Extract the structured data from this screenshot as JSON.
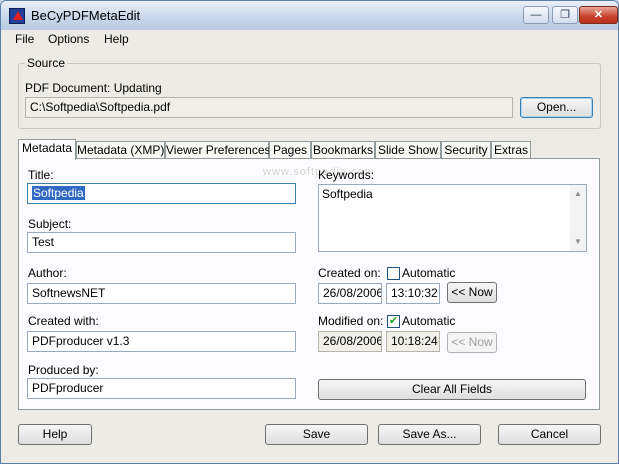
{
  "window": {
    "title": "BeCyPDFMetaEdit"
  },
  "titlebar_buttons": {
    "minimize": "—",
    "restore": "❐",
    "close": "✕"
  },
  "menu": [
    "File",
    "Options",
    "Help"
  ],
  "source": {
    "group_label": "Source",
    "doc_label": "PDF Document:  Updating",
    "path": "C:\\Softpedia\\Softpedia.pdf",
    "open_button": "Open..."
  },
  "tabs": [
    "Metadata",
    "Metadata (XMP)",
    "Viewer Preferences",
    "Pages",
    "Bookmarks",
    "Slide Show",
    "Security",
    "Extras"
  ],
  "metadata": {
    "title_label": "Title:",
    "title_value": "Softpedia",
    "subject_label": "Subject:",
    "subject_value": "Test",
    "author_label": "Author:",
    "author_value": "SoftnewsNET",
    "created_with_label": "Created with:",
    "created_with_value": "PDFproducer  v1.3",
    "produced_by_label": "Produced by:",
    "produced_by_value": "PDFproducer",
    "keywords_label": "Keywords:",
    "keywords_value": "Softpedia",
    "created_on_label": "Created on:",
    "created_automatic_label": "Automatic",
    "created_automatic_checked": false,
    "created_date": "26/08/2006",
    "created_time": "13:10:32",
    "created_now_button": "<< Now",
    "modified_on_label": "Modified on:",
    "modified_automatic_label": "Automatic",
    "modified_automatic_checked": true,
    "modified_date": "26/08/2006",
    "modified_time": "10:18:24",
    "modified_now_button": "<< Now",
    "clear_button": "Clear All Fields"
  },
  "watermark": "www.softpedia.com",
  "footer": {
    "help": "Help",
    "save": "Save",
    "save_as": "Save As...",
    "cancel": "Cancel"
  }
}
